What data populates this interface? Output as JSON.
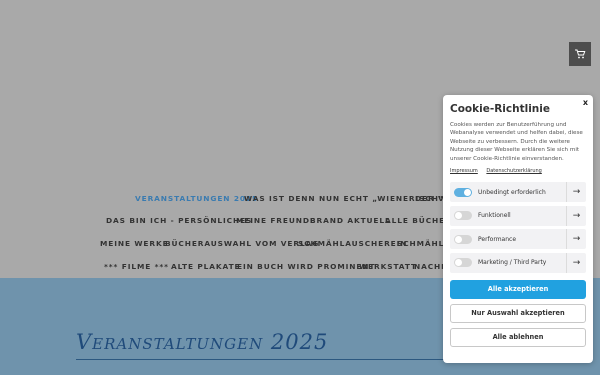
{
  "nav": {
    "row1": [
      "VERANSTALTUNGEN 2025",
      "WAS IST DENN NUN ECHT „WIENERISCH\"",
      "DER VE"
    ],
    "row2": [
      "DAS BIN ICH - PERSÖNLICHES",
      "MEINE FREUNDE",
      "BRAND AKTUELL",
      "ALLE BÜCHER"
    ],
    "row3": [
      "MEINE WERKE",
      "BÜCHERAUSWAHL VOM VERLAG",
      "SCHMÄHLAUSCHEREIN",
      "SCHMÄHLAU"
    ],
    "row4": [
      "*** FILME ***",
      "ALTE PLAKATE",
      "EIN BUCH WIRD PROMINENT",
      "WERKSTATT",
      "NACHR"
    ]
  },
  "content": {
    "headline": "Veranstaltungen 2025"
  },
  "cookie": {
    "title": "Cookie-Richtlinie",
    "close": "x",
    "text": "Cookies werden zur Benutzerführung und Webanalyse verwendet und helfen dabei, diese Webseite zu verbessern. Durch die weitere Nutzung dieser Webseite erklären Sie sich mit unserer Cookie-Richtlinie einverstanden.",
    "link_impressum": "Impressum",
    "link_privacy": "Datenschutzerklärung",
    "categories": [
      {
        "label": "Unbedingt erforderlich",
        "on": true
      },
      {
        "label": "Funktionell",
        "on": false
      },
      {
        "label": "Performance",
        "on": false
      },
      {
        "label": "Marketing / Third Party",
        "on": false
      }
    ],
    "accept_all": "Alle akzeptieren",
    "accept_selection": "Nur Auswahl akzeptieren",
    "reject_all": "Alle ablehnen",
    "accent": "#21a1e0"
  }
}
